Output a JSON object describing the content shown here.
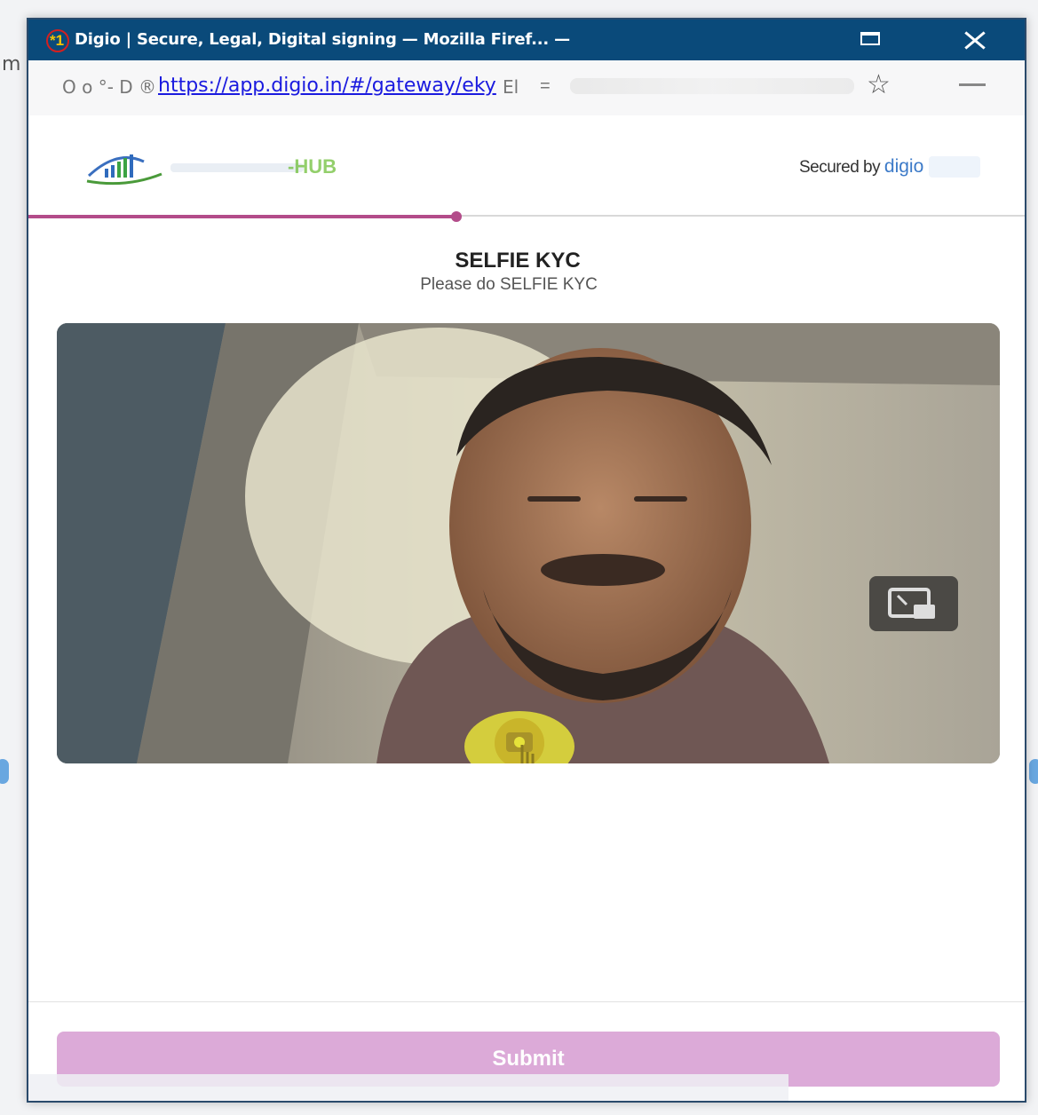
{
  "window": {
    "badge": "*1",
    "title": "Digio | Secure, Legal, Digital signing — Mozilla Firef... —",
    "maximize_icon": "maximize-icon",
    "close_icon": "close-icon"
  },
  "navbar": {
    "icons_text": "O o °- D ®",
    "url": "https://app.digio.in/#/gateway/eky",
    "url_tail": "El",
    "menu_text": "=",
    "bookmark_icon": "star-icon"
  },
  "header": {
    "brand_suffix": "-HUB",
    "secured_prefix": "Secured by",
    "secured_brand": "digio",
    "progress": 0.43
  },
  "content": {
    "title": "SELFIE KYC",
    "subtitle": "Please do SELFIE KYC"
  },
  "camera": {
    "pip_icon": "picture-in-picture-icon",
    "capture_icon": "camera-capture-icon"
  },
  "footer": {
    "submit_label": "Submit"
  },
  "colors": {
    "titlebar": "#0a4a7a",
    "progress": "#b34c8a",
    "submit": "#dcaad8",
    "link": "#1a1adf",
    "brand": "#3c7ac8"
  }
}
